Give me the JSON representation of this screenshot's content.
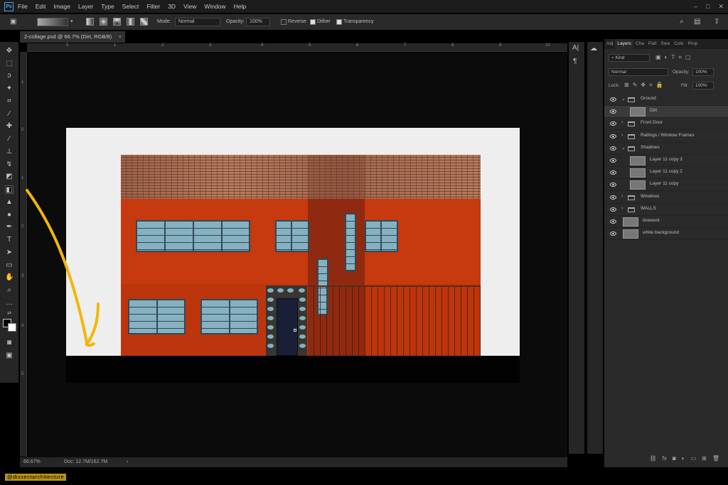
{
  "app": {
    "logo": "Ps"
  },
  "menu": [
    "File",
    "Edit",
    "Image",
    "Layer",
    "Type",
    "Select",
    "Filter",
    "3D",
    "View",
    "Window",
    "Help"
  ],
  "options": {
    "mode_label": "Mode:",
    "mode_value": "Normal",
    "opacity_label": "Opacity:",
    "opacity_value": "100%",
    "reverse_label": "Reverse",
    "dither_label": "Dither",
    "transparency_label": "Transparency"
  },
  "document": {
    "tab_title": "2-collage.psd @ 66.7% (Dirt, RGB/8)",
    "close": "×"
  },
  "ruler": {
    "h": [
      "0",
      "1",
      "2",
      "3",
      "4",
      "5",
      "6",
      "7",
      "8",
      "9",
      "10"
    ],
    "v": [
      "1",
      "0",
      "1",
      "2",
      "3",
      "4",
      "5"
    ]
  },
  "status": {
    "zoom": "66.67%",
    "doc": "Doc: 12.7M/162.7M"
  },
  "watermark": "@dissectarchitecture",
  "panel": {
    "tabs": [
      "Adj",
      "Layers",
      "Cha",
      "Patt",
      "Swa",
      "Colo",
      "Prop"
    ],
    "active_tab": "Layers",
    "kind_label": "Kind",
    "blend_mode": "Normal",
    "opacity_label": "Opacity:",
    "opacity_value": "100%",
    "lock_label": "Lock:",
    "fill_label": "Fill:",
    "fill_value": "100%"
  },
  "layers": [
    {
      "name": "Ground",
      "type": "group",
      "indent": 0,
      "open": true
    },
    {
      "name": "Dirt",
      "type": "layer",
      "indent": 1,
      "selected": true
    },
    {
      "name": "Front Door",
      "type": "group",
      "indent": 0,
      "open": false
    },
    {
      "name": "Railings / Window Frames",
      "type": "group",
      "indent": 0,
      "open": false
    },
    {
      "name": "Shadows",
      "type": "group",
      "indent": 0,
      "open": true
    },
    {
      "name": "Layer 11 copy 3",
      "type": "layer",
      "indent": 1
    },
    {
      "name": "Layer 11 copy 2",
      "type": "layer",
      "indent": 1
    },
    {
      "name": "Layer 11 copy",
      "type": "layer",
      "indent": 1
    },
    {
      "name": "Windows",
      "type": "group",
      "indent": 0,
      "open": false
    },
    {
      "name": "WALLS",
      "type": "group",
      "indent": 0,
      "open": false
    },
    {
      "name": "linework",
      "type": "layer",
      "indent": 0
    },
    {
      "name": "white background",
      "type": "layer",
      "indent": 0
    }
  ],
  "colors": {
    "accent_yellow": "#f2b705",
    "wall_orange": "#c7390e",
    "window_blue": "#86b1c1"
  }
}
